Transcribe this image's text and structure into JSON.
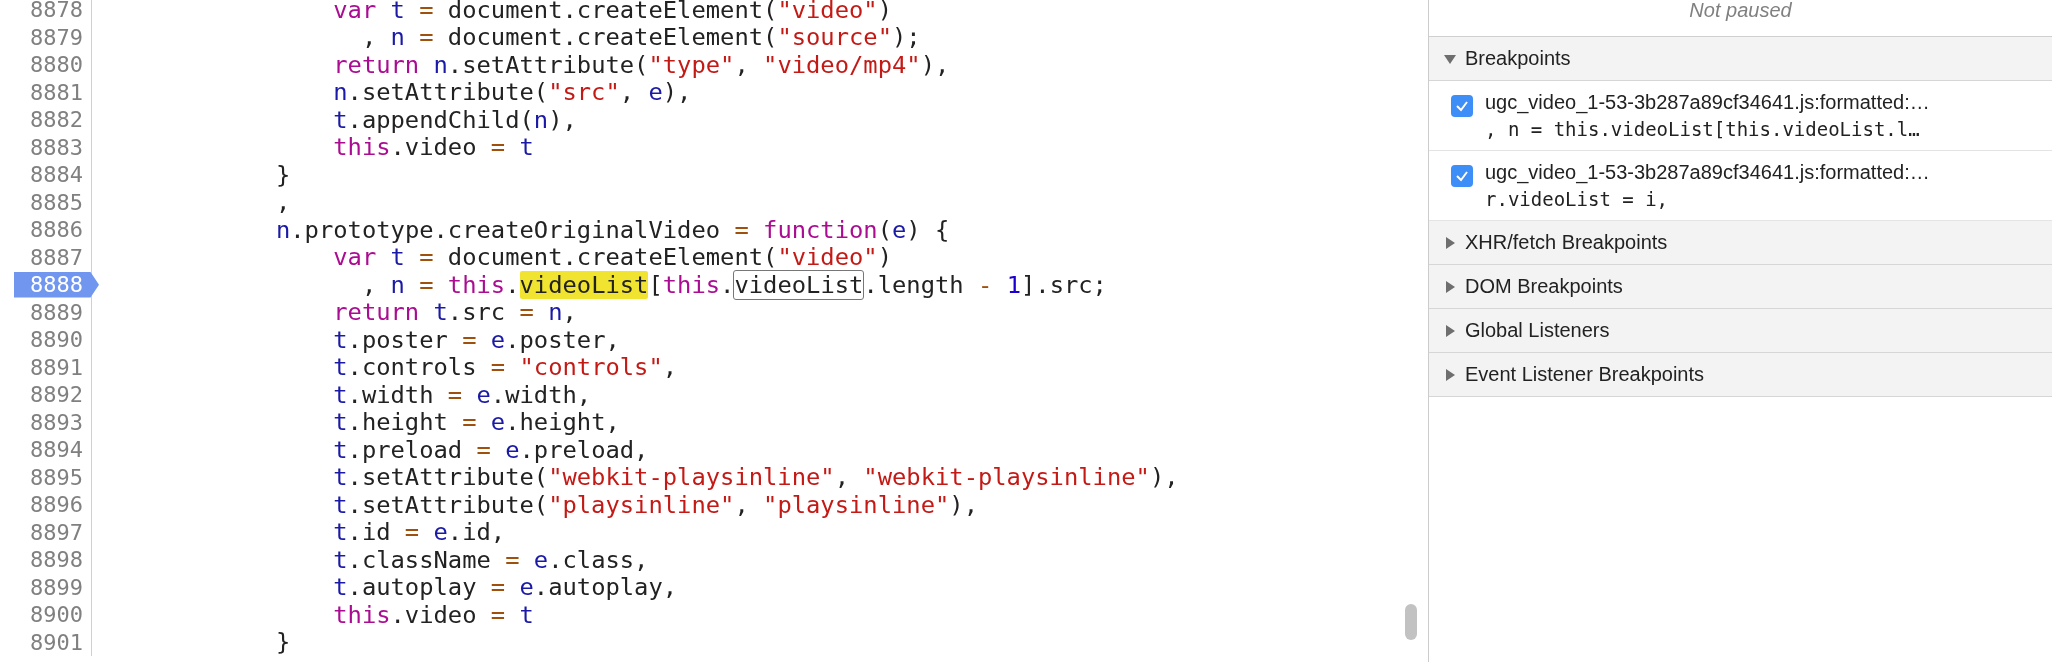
{
  "editor": {
    "lines": [
      {
        "number": "8878",
        "current": false,
        "tokens": [
          {
            "text": "                var",
            "kind": "keyword"
          },
          {
            "text": " t",
            "kind": "ident"
          },
          {
            "text": " =",
            "kind": "op"
          },
          {
            "text": " document.createElement(",
            "kind": "plain"
          },
          {
            "text": "\"video\"",
            "kind": "string"
          },
          {
            "text": ")",
            "kind": "plain"
          }
        ]
      },
      {
        "number": "8879",
        "current": false,
        "tokens": [
          {
            "text": "                  ,",
            "kind": "plain"
          },
          {
            "text": " n",
            "kind": "ident"
          },
          {
            "text": " =",
            "kind": "op"
          },
          {
            "text": " document.createElement(",
            "kind": "plain"
          },
          {
            "text": "\"source\"",
            "kind": "string"
          },
          {
            "text": ");",
            "kind": "plain"
          }
        ]
      },
      {
        "number": "8880",
        "current": false,
        "tokens": [
          {
            "text": "                return",
            "kind": "keyword"
          },
          {
            "text": " n",
            "kind": "ident"
          },
          {
            "text": ".setAttribute(",
            "kind": "plain"
          },
          {
            "text": "\"type\"",
            "kind": "string"
          },
          {
            "text": ", ",
            "kind": "plain"
          },
          {
            "text": "\"video/mp4\"",
            "kind": "string"
          },
          {
            "text": "),",
            "kind": "plain"
          }
        ]
      },
      {
        "number": "8881",
        "current": false,
        "tokens": [
          {
            "text": "                n",
            "kind": "ident"
          },
          {
            "text": ".setAttribute(",
            "kind": "plain"
          },
          {
            "text": "\"src\"",
            "kind": "string"
          },
          {
            "text": ",",
            "kind": "plain"
          },
          {
            "text": " e",
            "kind": "ident"
          },
          {
            "text": "),",
            "kind": "plain"
          }
        ]
      },
      {
        "number": "8882",
        "current": false,
        "tokens": [
          {
            "text": "                t",
            "kind": "ident"
          },
          {
            "text": ".appendChild(",
            "kind": "plain"
          },
          {
            "text": "n",
            "kind": "ident"
          },
          {
            "text": "),",
            "kind": "plain"
          }
        ]
      },
      {
        "number": "8883",
        "current": false,
        "tokens": [
          {
            "text": "                this",
            "kind": "keyword"
          },
          {
            "text": ".video",
            "kind": "plain"
          },
          {
            "text": " =",
            "kind": "op"
          },
          {
            "text": " t",
            "kind": "ident"
          }
        ]
      },
      {
        "number": "8884",
        "current": false,
        "tokens": [
          {
            "text": "            }",
            "kind": "plain"
          }
        ]
      },
      {
        "number": "8885",
        "current": false,
        "tokens": [
          {
            "text": "            ,",
            "kind": "plain"
          }
        ]
      },
      {
        "number": "8886",
        "current": false,
        "tokens": [
          {
            "text": "            n",
            "kind": "ident"
          },
          {
            "text": ".prototype.createOriginalVideo",
            "kind": "plain"
          },
          {
            "text": " =",
            "kind": "op"
          },
          {
            "text": " function",
            "kind": "keyword"
          },
          {
            "text": "(",
            "kind": "plain"
          },
          {
            "text": "e",
            "kind": "ident"
          },
          {
            "text": ") {",
            "kind": "plain"
          }
        ]
      },
      {
        "number": "8887",
        "current": false,
        "tokens": [
          {
            "text": "                var",
            "kind": "keyword"
          },
          {
            "text": " t",
            "kind": "ident"
          },
          {
            "text": " =",
            "kind": "op"
          },
          {
            "text": " document.createElement(",
            "kind": "plain"
          },
          {
            "text": "\"video\"",
            "kind": "string"
          },
          {
            "text": ")",
            "kind": "plain"
          }
        ]
      },
      {
        "number": "8888",
        "current": true,
        "tokens": [
          {
            "text": "                  ,",
            "kind": "plain"
          },
          {
            "text": " n",
            "kind": "ident"
          },
          {
            "text": " =",
            "kind": "op"
          },
          {
            "text": " this",
            "kind": "keyword"
          },
          {
            "text": ".",
            "kind": "plain"
          },
          {
            "text": "videoList",
            "kind": "match"
          },
          {
            "text": "[",
            "kind": "plain"
          },
          {
            "text": "this",
            "kind": "keyword"
          },
          {
            "text": ".",
            "kind": "plain"
          },
          {
            "text": "videoList",
            "kind": "boxed"
          },
          {
            "text": ".length",
            "kind": "plain"
          },
          {
            "text": " -",
            "kind": "op"
          },
          {
            "text": " 1",
            "kind": "number"
          },
          {
            "text": "].src;",
            "kind": "plain"
          }
        ]
      },
      {
        "number": "8889",
        "current": false,
        "tokens": [
          {
            "text": "                return",
            "kind": "keyword"
          },
          {
            "text": " t",
            "kind": "ident"
          },
          {
            "text": ".src",
            "kind": "plain"
          },
          {
            "text": " =",
            "kind": "op"
          },
          {
            "text": " n",
            "kind": "ident"
          },
          {
            "text": ",",
            "kind": "plain"
          }
        ]
      },
      {
        "number": "8890",
        "current": false,
        "tokens": [
          {
            "text": "                t",
            "kind": "ident"
          },
          {
            "text": ".poster",
            "kind": "plain"
          },
          {
            "text": " =",
            "kind": "op"
          },
          {
            "text": " e",
            "kind": "ident"
          },
          {
            "text": ".poster,",
            "kind": "plain"
          }
        ]
      },
      {
        "number": "8891",
        "current": false,
        "tokens": [
          {
            "text": "                t",
            "kind": "ident"
          },
          {
            "text": ".controls",
            "kind": "plain"
          },
          {
            "text": " =",
            "kind": "op"
          },
          {
            "text": " \"controls\"",
            "kind": "string"
          },
          {
            "text": ",",
            "kind": "plain"
          }
        ]
      },
      {
        "number": "8892",
        "current": false,
        "tokens": [
          {
            "text": "                t",
            "kind": "ident"
          },
          {
            "text": ".width",
            "kind": "plain"
          },
          {
            "text": " =",
            "kind": "op"
          },
          {
            "text": " e",
            "kind": "ident"
          },
          {
            "text": ".width,",
            "kind": "plain"
          }
        ]
      },
      {
        "number": "8893",
        "current": false,
        "tokens": [
          {
            "text": "                t",
            "kind": "ident"
          },
          {
            "text": ".height",
            "kind": "plain"
          },
          {
            "text": " =",
            "kind": "op"
          },
          {
            "text": " e",
            "kind": "ident"
          },
          {
            "text": ".height,",
            "kind": "plain"
          }
        ]
      },
      {
        "number": "8894",
        "current": false,
        "tokens": [
          {
            "text": "                t",
            "kind": "ident"
          },
          {
            "text": ".preload",
            "kind": "plain"
          },
          {
            "text": " =",
            "kind": "op"
          },
          {
            "text": " e",
            "kind": "ident"
          },
          {
            "text": ".preload,",
            "kind": "plain"
          }
        ]
      },
      {
        "number": "8895",
        "current": false,
        "tokens": [
          {
            "text": "                t",
            "kind": "ident"
          },
          {
            "text": ".setAttribute(",
            "kind": "plain"
          },
          {
            "text": "\"webkit-playsinline\"",
            "kind": "string"
          },
          {
            "text": ",",
            "kind": "plain"
          },
          {
            "text": " \"webkit-playsinline\"",
            "kind": "string"
          },
          {
            "text": "),",
            "kind": "plain"
          }
        ]
      },
      {
        "number": "8896",
        "current": false,
        "tokens": [
          {
            "text": "                t",
            "kind": "ident"
          },
          {
            "text": ".setAttribute(",
            "kind": "plain"
          },
          {
            "text": "\"playsinline\"",
            "kind": "string"
          },
          {
            "text": ",",
            "kind": "plain"
          },
          {
            "text": " \"playsinline\"",
            "kind": "string"
          },
          {
            "text": "),",
            "kind": "plain"
          }
        ]
      },
      {
        "number": "8897",
        "current": false,
        "tokens": [
          {
            "text": "                t",
            "kind": "ident"
          },
          {
            "text": ".id",
            "kind": "plain"
          },
          {
            "text": " =",
            "kind": "op"
          },
          {
            "text": " e",
            "kind": "ident"
          },
          {
            "text": ".id,",
            "kind": "plain"
          }
        ]
      },
      {
        "number": "8898",
        "current": false,
        "tokens": [
          {
            "text": "                t",
            "kind": "ident"
          },
          {
            "text": ".className",
            "kind": "plain"
          },
          {
            "text": " =",
            "kind": "op"
          },
          {
            "text": " e",
            "kind": "ident"
          },
          {
            "text": ".class,",
            "kind": "plain"
          }
        ]
      },
      {
        "number": "8899",
        "current": false,
        "tokens": [
          {
            "text": "                t",
            "kind": "ident"
          },
          {
            "text": ".autoplay",
            "kind": "plain"
          },
          {
            "text": " =",
            "kind": "op"
          },
          {
            "text": " e",
            "kind": "ident"
          },
          {
            "text": ".autoplay,",
            "kind": "plain"
          }
        ]
      },
      {
        "number": "8900",
        "current": false,
        "tokens": [
          {
            "text": "                this",
            "kind": "keyword"
          },
          {
            "text": ".video",
            "kind": "plain"
          },
          {
            "text": " =",
            "kind": "op"
          },
          {
            "text": " t",
            "kind": "ident"
          }
        ]
      },
      {
        "number": "8901",
        "current": false,
        "tokens": [
          {
            "text": "            }",
            "kind": "plain"
          }
        ]
      }
    ]
  },
  "sidebar": {
    "status": "Not paused",
    "sections": [
      {
        "title": "Breakpoints",
        "expanded": true,
        "items": [
          {
            "file": "ugc_video_1-53-3b287a89cf34641.js:formatted:…",
            "code": ", n = this.videoList[this.videoList.l…",
            "checked": true
          },
          {
            "file": "ugc_video_1-53-3b287a89cf34641.js:formatted:…",
            "code": "r.videoList = i,",
            "checked": true
          }
        ]
      },
      {
        "title": "XHR/fetch Breakpoints",
        "expanded": false
      },
      {
        "title": "DOM Breakpoints",
        "expanded": false
      },
      {
        "title": "Global Listeners",
        "expanded": false
      },
      {
        "title": "Event Listener Breakpoints",
        "expanded": false
      }
    ]
  }
}
